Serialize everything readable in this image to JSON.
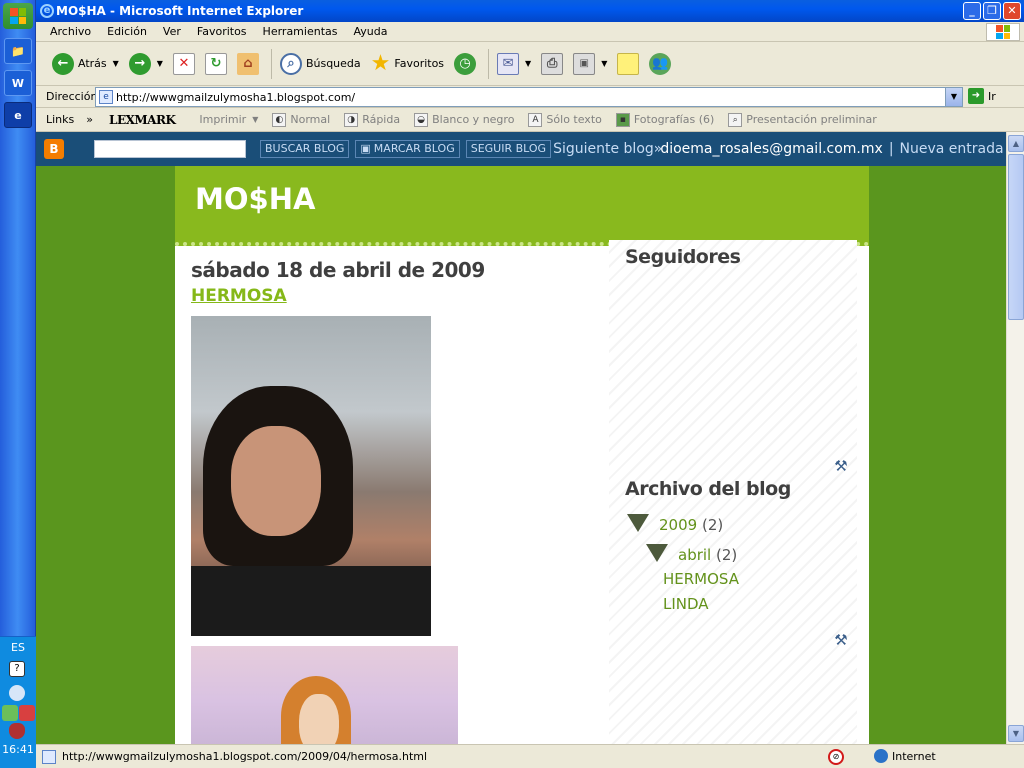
{
  "window": {
    "title": "MO$HA - Microsoft Internet Explorer"
  },
  "menu": [
    "Archivo",
    "Edición",
    "Ver",
    "Favoritos",
    "Herramientas",
    "Ayuda"
  ],
  "toolbar": {
    "back": "Atrás",
    "search": "Búsqueda",
    "favorites": "Favoritos"
  },
  "address": {
    "label": "Dirección",
    "url": "http://wwwgmailzulymosha1.blogspot.com/",
    "go": "Ir"
  },
  "links": {
    "label": "Links",
    "lexmark": "LEXMARK",
    "items": [
      "Imprimir",
      "Normal",
      "Rápida",
      "Blanco y negro",
      "Sólo texto",
      "Fotografías (6)",
      "Presentación preliminar"
    ]
  },
  "navbar": {
    "search_btn": "BUSCAR BLOG",
    "mark_btn": "MARCAR BLOG",
    "follow_btn": "SEGUIR BLOG",
    "next": "Siguiente blog»",
    "email": "dioema_rosales@gmail.com.mx",
    "separator": "|",
    "new_post": "Nueva entrada"
  },
  "blog": {
    "title": "MO$HA",
    "post_date": "sábado 18 de abril de 2009",
    "post_title": "HERMOSA",
    "followers_heading": "Seguidores",
    "archive_heading": "Archivo del blog",
    "archive_year": "2009",
    "archive_year_count": "(2)",
    "archive_month": "abril",
    "archive_month_count": "(2)",
    "archive_posts": [
      "HERMOSA",
      "LINDA"
    ]
  },
  "status": {
    "url": "http://wwwgmailzulymosha1.blogspot.com/2009/04/hermosa.html",
    "zone": "Internet"
  },
  "taskbar": {
    "lang": "ES",
    "clock": "16:41"
  }
}
